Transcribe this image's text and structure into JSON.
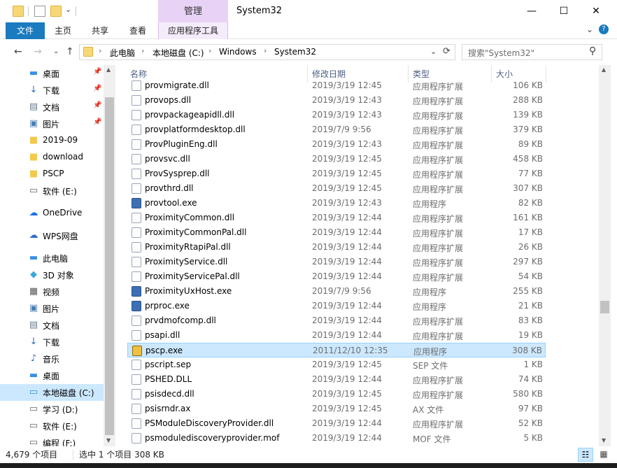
{
  "window": {
    "title": "System32",
    "context_tab_header": "管理",
    "minimize": "—",
    "maximize": "☐",
    "close": "✕"
  },
  "ribbon": {
    "tabs": [
      "文件",
      "主页",
      "共享",
      "查看",
      "应用程序工具"
    ],
    "expand": "⌄",
    "help": "?"
  },
  "address": {
    "crumbs": [
      "此电脑",
      "本地磁盘 (C:)",
      "Windows",
      "System32"
    ],
    "separator": "›",
    "dropdown": "⌄",
    "refresh": "⟳",
    "search_placeholder": "搜索\"System32\"",
    "search_icon": "⚲",
    "back": "←",
    "forward": "→",
    "recent": "⌄",
    "up": "↑"
  },
  "nav": {
    "pin": "📌",
    "items": [
      {
        "label": "桌面",
        "icon": "desktop-icon",
        "glyph": "▬",
        "color": "#3a8ee6",
        "pinned": true
      },
      {
        "label": "下载",
        "icon": "download-icon",
        "glyph": "↓",
        "color": "#2a6fc9",
        "pinned": true
      },
      {
        "label": "文档",
        "icon": "document-icon",
        "glyph": "▤",
        "color": "#6b7c93",
        "pinned": true
      },
      {
        "label": "图片",
        "icon": "picture-icon",
        "glyph": "▣",
        "color": "#4a7fb5",
        "pinned": true
      },
      {
        "label": "2019-09",
        "icon": "folder-icon",
        "glyph": "■",
        "color": "#f2c94c",
        "pinned": false
      },
      {
        "label": "download",
        "icon": "folder-icon",
        "glyph": "■",
        "color": "#f2c94c",
        "pinned": false
      },
      {
        "label": "PSCP",
        "icon": "folder-icon",
        "glyph": "■",
        "color": "#f2c94c",
        "pinned": false
      },
      {
        "label": "软件 (E:)",
        "icon": "drive-icon",
        "glyph": "▭",
        "color": "#666666",
        "pinned": false
      },
      {
        "label": "OneDrive",
        "icon": "onedrive-icon",
        "glyph": "☁",
        "color": "#1a73e8",
        "pinned": false
      },
      {
        "label": "WPS网盘",
        "icon": "wps-cloud-icon",
        "glyph": "☁",
        "color": "#2d6ccc",
        "pinned": false
      },
      {
        "label": "此电脑",
        "icon": "this-pc-icon",
        "glyph": "▬",
        "color": "#3a8ee6",
        "pinned": false
      },
      {
        "label": "3D 对象",
        "icon": "3d-objects-icon",
        "glyph": "◆",
        "color": "#39a9dc",
        "pinned": false
      },
      {
        "label": "视频",
        "icon": "video-icon",
        "glyph": "▦",
        "color": "#555555",
        "pinned": false
      },
      {
        "label": "图片",
        "icon": "picture-icon",
        "glyph": "▣",
        "color": "#4a7fb5",
        "pinned": false
      },
      {
        "label": "文档",
        "icon": "document-icon",
        "glyph": "▤",
        "color": "#6b7c93",
        "pinned": false
      },
      {
        "label": "下载",
        "icon": "download-icon",
        "glyph": "↓",
        "color": "#2a6fc9",
        "pinned": false
      },
      {
        "label": "音乐",
        "icon": "music-icon",
        "glyph": "♪",
        "color": "#2a6fc9",
        "pinned": false
      },
      {
        "label": "桌面",
        "icon": "desktop-icon",
        "glyph": "▬",
        "color": "#3a8ee6",
        "pinned": false
      },
      {
        "label": "本地磁盘 (C:)",
        "icon": "windows-drive-icon",
        "glyph": "▭",
        "color": "#3a8ee6",
        "pinned": false
      },
      {
        "label": "学习 (D:)",
        "icon": "drive-icon",
        "glyph": "▭",
        "color": "#666666",
        "pinned": false
      },
      {
        "label": "软件 (E:)",
        "icon": "drive-icon",
        "glyph": "▭",
        "color": "#666666",
        "pinned": false
      },
      {
        "label": "编程 (F:)",
        "icon": "drive-icon",
        "glyph": "▭",
        "color": "#666666",
        "pinned": false
      }
    ],
    "scroll_up": "▲",
    "scroll_down": "▼"
  },
  "columns": {
    "name": "名称",
    "date": "修改日期",
    "type": "类型",
    "size": "大小",
    "sort_arrow": "⌃"
  },
  "files": [
    {
      "name": "provmigrate.dll",
      "date": "2019/3/19 12:45",
      "type": "应用程序扩展",
      "size": "106 KB",
      "kind": "dll"
    },
    {
      "name": "provops.dll",
      "date": "2019/3/19 12:43",
      "type": "应用程序扩展",
      "size": "288 KB",
      "kind": "dll"
    },
    {
      "name": "provpackageapidll.dll",
      "date": "2019/3/19 12:43",
      "type": "应用程序扩展",
      "size": "139 KB",
      "kind": "dll"
    },
    {
      "name": "provplatformdesktop.dll",
      "date": "2019/7/9 9:56",
      "type": "应用程序扩展",
      "size": "379 KB",
      "kind": "dll"
    },
    {
      "name": "ProvPluginEng.dll",
      "date": "2019/3/19 12:43",
      "type": "应用程序扩展",
      "size": "89 KB",
      "kind": "dll"
    },
    {
      "name": "provsvc.dll",
      "date": "2019/3/19 12:45",
      "type": "应用程序扩展",
      "size": "458 KB",
      "kind": "dll"
    },
    {
      "name": "ProvSysprep.dll",
      "date": "2019/3/19 12:45",
      "type": "应用程序扩展",
      "size": "77 KB",
      "kind": "dll"
    },
    {
      "name": "provthrd.dll",
      "date": "2019/3/19 12:45",
      "type": "应用程序扩展",
      "size": "307 KB",
      "kind": "dll"
    },
    {
      "name": "provtool.exe",
      "date": "2019/3/19 12:43",
      "type": "应用程序",
      "size": "82 KB",
      "kind": "exe"
    },
    {
      "name": "ProximityCommon.dll",
      "date": "2019/3/19 12:44",
      "type": "应用程序扩展",
      "size": "161 KB",
      "kind": "dll"
    },
    {
      "name": "ProximityCommonPal.dll",
      "date": "2019/3/19 12:44",
      "type": "应用程序扩展",
      "size": "17 KB",
      "kind": "dll"
    },
    {
      "name": "ProximityRtapiPal.dll",
      "date": "2019/3/19 12:44",
      "type": "应用程序扩展",
      "size": "26 KB",
      "kind": "dll"
    },
    {
      "name": "ProximityService.dll",
      "date": "2019/3/19 12:44",
      "type": "应用程序扩展",
      "size": "297 KB",
      "kind": "dll"
    },
    {
      "name": "ProximityServicePal.dll",
      "date": "2019/3/19 12:44",
      "type": "应用程序扩展",
      "size": "54 KB",
      "kind": "dll"
    },
    {
      "name": "ProximityUxHost.exe",
      "date": "2019/7/9 9:56",
      "type": "应用程序",
      "size": "255 KB",
      "kind": "exe"
    },
    {
      "name": "prproc.exe",
      "date": "2019/3/19 12:44",
      "type": "应用程序",
      "size": "21 KB",
      "kind": "exe"
    },
    {
      "name": "prvdmofcomp.dll",
      "date": "2019/3/19 12:44",
      "type": "应用程序扩展",
      "size": "83 KB",
      "kind": "dll"
    },
    {
      "name": "psapi.dll",
      "date": "2019/3/19 12:44",
      "type": "应用程序扩展",
      "size": "19 KB",
      "kind": "dll"
    },
    {
      "name": "pscp.exe",
      "date": "2011/12/10 12:35",
      "type": "应用程序",
      "size": "308 KB",
      "kind": "pscp",
      "selected": true
    },
    {
      "name": "pscript.sep",
      "date": "2019/3/19 12:45",
      "type": "SEP 文件",
      "size": "1 KB",
      "kind": "file"
    },
    {
      "name": "PSHED.DLL",
      "date": "2019/3/19 12:44",
      "type": "应用程序扩展",
      "size": "74 KB",
      "kind": "dll"
    },
    {
      "name": "psisdecd.dll",
      "date": "2019/3/19 12:45",
      "type": "应用程序扩展",
      "size": "580 KB",
      "kind": "dll"
    },
    {
      "name": "psisrndr.ax",
      "date": "2019/3/19 12:45",
      "type": "AX 文件",
      "size": "97 KB",
      "kind": "file"
    },
    {
      "name": "PSModuleDiscoveryProvider.dll",
      "date": "2019/3/19 12:44",
      "type": "应用程序扩展",
      "size": "52 KB",
      "kind": "dll"
    },
    {
      "name": "psmodulediscoveryprovider.mof",
      "date": "2019/3/19 12:44",
      "type": "MOF 文件",
      "size": "5 KB",
      "kind": "file"
    }
  ],
  "list_scroll": {
    "up": "▲",
    "down": "▼"
  },
  "status": {
    "count": "4,679 个项目",
    "selection": "选中 1 个项目  308 KB",
    "view_details": "☷",
    "view_icons": "▦"
  }
}
